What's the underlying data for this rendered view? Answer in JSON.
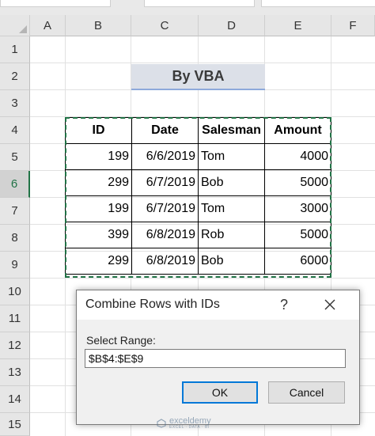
{
  "columns": [
    "A",
    "B",
    "C",
    "D",
    "E",
    "F"
  ],
  "rows": [
    "1",
    "2",
    "3",
    "4",
    "5",
    "6",
    "7",
    "8",
    "9",
    "10",
    "11",
    "12",
    "13",
    "14",
    "15"
  ],
  "active_row": "6",
  "title_cell": "By VBA",
  "table": {
    "headers": [
      "ID",
      "Date",
      "Salesman",
      "Amount"
    ],
    "rows": [
      [
        "199",
        "6/6/2019",
        "Tom",
        "4000"
      ],
      [
        "299",
        "6/7/2019",
        "Bob",
        "5000"
      ],
      [
        "199",
        "6/7/2019",
        "Tom",
        "3000"
      ],
      [
        "399",
        "6/8/2019",
        "Rob",
        "5000"
      ],
      [
        "299",
        "6/8/2019",
        "Bob",
        "6000"
      ]
    ]
  },
  "dialog": {
    "title": "Combine Rows with IDs",
    "help_label": "?",
    "label": "Select Range:",
    "input_value": "$B$4:$E$9",
    "ok_label": "OK",
    "cancel_label": "Cancel"
  },
  "colors": {
    "selection_border": "#217346",
    "title_fill": "#dce0e8",
    "title_underline": "#8ea9db",
    "ok_focus": "#0078d7"
  },
  "icons": {
    "corner": "select-all-triangle-icon",
    "close": "close-x-icon",
    "help": "help-question-icon",
    "watermark": "exceldemy-logo-icon"
  },
  "watermark": {
    "name": "exceldemy",
    "tagline": "EXCEL · DATA · BI"
  }
}
